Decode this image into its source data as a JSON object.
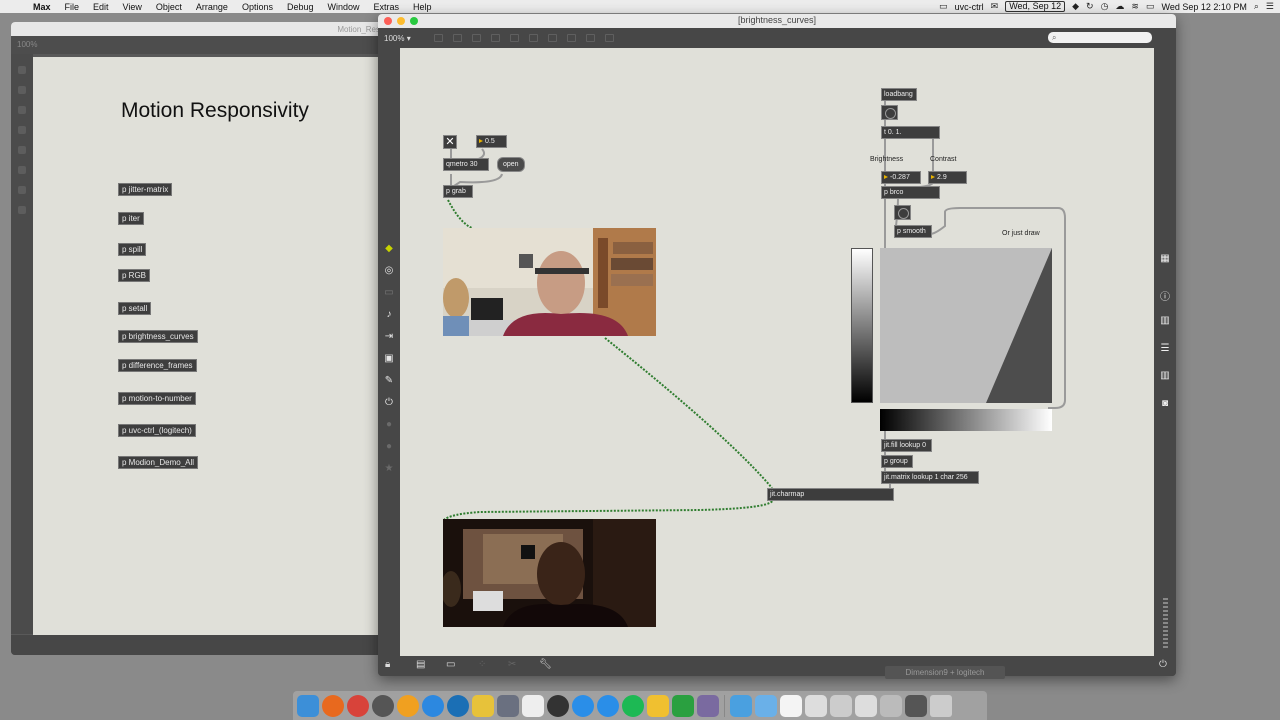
{
  "menubar": {
    "app_name": "Max",
    "items": [
      "File",
      "Edit",
      "View",
      "Object",
      "Arrange",
      "Options",
      "Debug",
      "Window",
      "Extras",
      "Help"
    ],
    "status_app": "uvc-ctrl",
    "date_box": "Wed, Sep 12",
    "clock": "Wed Sep 12  2:10 PM"
  },
  "back_window": {
    "title_fragment": "Motion_Res",
    "zoom": "100%",
    "heading": "Motion Responsivity",
    "subpatchers": [
      "p jitter-matrix",
      "p iter",
      "p spill",
      "p RGB",
      "p setall",
      "p brightness_curves",
      "p difference_frames",
      "p motion-to-number",
      "p uvc-ctrl_(logitech)",
      "p Modion_Demo_All"
    ]
  },
  "front_window": {
    "title": "[brightness_curves]",
    "zoom": "100%",
    "search_placeholder": "",
    "objects": {
      "toggle": "✕",
      "float_value": "0.5",
      "qmetro": "qmetro 30",
      "open_msg": "open",
      "p_grab": "p grab",
      "loadbang": "loadbang",
      "init_msg": "t 0. 1.",
      "brightness_label": "Brightness",
      "contrast_label": "Contrast",
      "brightness_value": "-0.287",
      "contrast_value": "2.9",
      "p_brco": "p brco",
      "p_smooth": "p smooth",
      "draw_comment": "Or just draw",
      "fill_lookup": "jit.fill lookup 0",
      "p_group": "p group",
      "lookup_matrix": "jit.matrix lookup 1 char 256",
      "charmap": "jit.charmap"
    }
  },
  "tooltip": "Dimension9 + logitech",
  "colors": {
    "canvas": "#e0e0d9",
    "patch_cord": "#2f7d2f",
    "object_bg": "#3d3d3d",
    "number_arrow": "#e6b200"
  },
  "icons": [
    "cube-icon",
    "circle-icon",
    "film-icon",
    "music-note-icon",
    "arrows-icon",
    "image-icon",
    "paperclip-icon",
    "plug-icon",
    "info-icon",
    "book-icon",
    "list-icon",
    "camera-icon",
    "lock-icon",
    "presentation-icon",
    "grid-icon",
    "wrench-icon",
    "power-icon"
  ]
}
